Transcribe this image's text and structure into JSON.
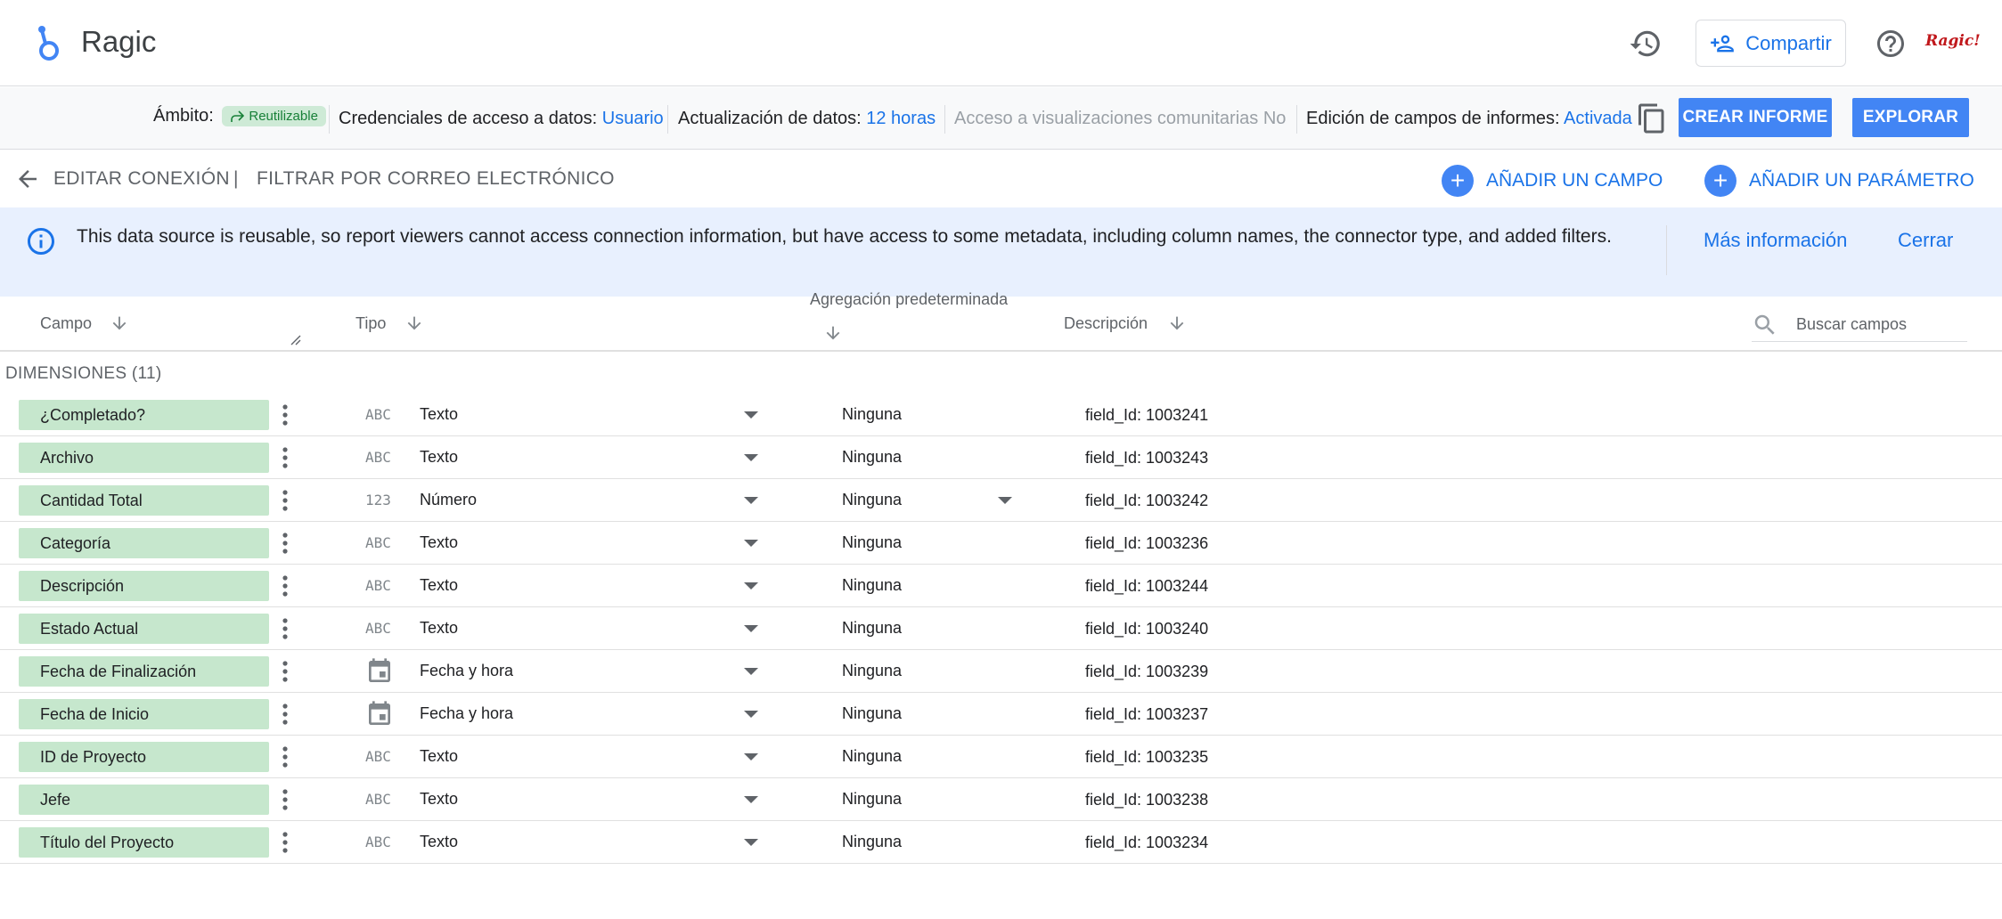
{
  "header": {
    "app_title": "Ragic",
    "share_label": "Compartir",
    "brand_mark": "Ragic!"
  },
  "settings": {
    "scope_label": "Ámbito:",
    "scope_chip": "Reutilizable",
    "credentials_label": "Credenciales de acceso a datos:",
    "credentials_value": "Usuario",
    "refresh_label": "Actualización de datos:",
    "refresh_value": "12 horas",
    "community_label": "Acceso a visualizaciones comunitarias No",
    "editing_label": "Edición de campos de informes:",
    "editing_value": "Activada",
    "create_report": "CREAR INFORME",
    "explore": "EXPLORAR"
  },
  "nav": {
    "edit_connection": "EDITAR CONEXIÓN",
    "separator": "|",
    "filter_email": "FILTRAR POR CORREO ELECTRÓNICO",
    "add_field": "AÑADIR UN CAMPO",
    "add_parameter": "AÑADIR UN PARÁMETRO"
  },
  "banner": {
    "text": "This data source is reusable, so report viewers cannot access connection information, but have access to some metadata, including column names, the connector type, and added filters.",
    "more_info": "Más información",
    "close": "Cerrar"
  },
  "columns": {
    "field": "Campo",
    "type": "Tipo",
    "aggregation": "Agregación predeterminada",
    "description": "Descripción",
    "search_placeholder": "Buscar campos"
  },
  "section": {
    "label": "DIMENSIONES (11)"
  },
  "rows": [
    {
      "name": "¿Completado?",
      "type_icon": "ABC",
      "type": "Texto",
      "aggregation": "Ninguna",
      "description": "field_Id: 1003241"
    },
    {
      "name": "Archivo",
      "type_icon": "ABC",
      "type": "Texto",
      "aggregation": "Ninguna",
      "description": "field_Id: 1003243"
    },
    {
      "name": "Cantidad Total",
      "type_icon": "123",
      "type": "Número",
      "aggregation": "Ninguna",
      "description": "field_Id: 1003242"
    },
    {
      "name": "Categoría",
      "type_icon": "ABC",
      "type": "Texto",
      "aggregation": "Ninguna",
      "description": "field_Id: 1003236"
    },
    {
      "name": "Descripción",
      "type_icon": "ABC",
      "type": "Texto",
      "aggregation": "Ninguna",
      "description": "field_Id: 1003244"
    },
    {
      "name": "Estado Actual",
      "type_icon": "ABC",
      "type": "Texto",
      "aggregation": "Ninguna",
      "description": "field_Id: 1003240"
    },
    {
      "name": "Fecha de Finalización",
      "type_icon": "calendar",
      "type": "Fecha y hora",
      "aggregation": "Ninguna",
      "description": "field_Id: 1003239"
    },
    {
      "name": "Fecha de Inicio",
      "type_icon": "calendar",
      "type": "Fecha y hora",
      "aggregation": "Ninguna",
      "description": "field_Id: 1003237"
    },
    {
      "name": "ID de Proyecto",
      "type_icon": "ABC",
      "type": "Texto",
      "aggregation": "Ninguna",
      "description": "field_Id: 1003235"
    },
    {
      "name": "Jefe",
      "type_icon": "ABC",
      "type": "Texto",
      "aggregation": "Ninguna",
      "description": "field_Id: 1003238"
    },
    {
      "name": "Título del Proyecto",
      "type_icon": "ABC",
      "type": "Texto",
      "aggregation": "Ninguna",
      "description": "field_Id: 1003234"
    }
  ],
  "colors": {
    "accent": "#1a73e8",
    "primary_button": "#4285f4",
    "field_chip": "#c6e7cd",
    "banner": "#e8f0fe"
  }
}
